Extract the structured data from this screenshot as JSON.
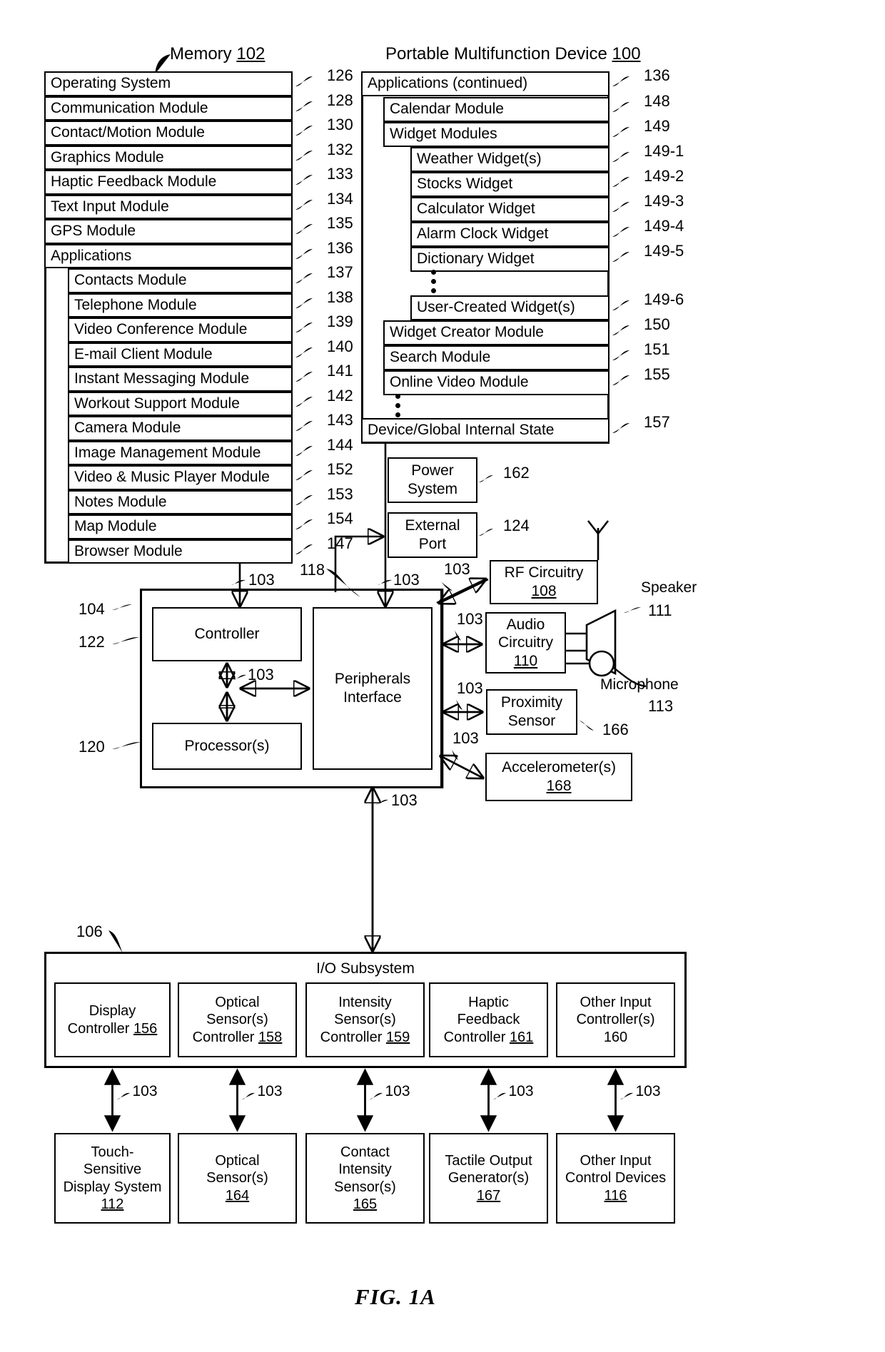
{
  "figure": {
    "caption": "FIG. 1A",
    "memory_title": "Memory",
    "memory_ref": "102",
    "device_title": "Portable Multifunction Device",
    "device_ref": "100"
  },
  "memory_column": {
    "items": [
      {
        "label": "Operating System",
        "ref": "126",
        "indent": 0
      },
      {
        "label": "Communication Module",
        "ref": "128",
        "indent": 0
      },
      {
        "label": "Contact/Motion Module",
        "ref": "130",
        "indent": 0
      },
      {
        "label": "Graphics Module",
        "ref": "132",
        "indent": 0
      },
      {
        "label": "Haptic Feedback Module",
        "ref": "133",
        "indent": 0
      },
      {
        "label": "Text Input Module",
        "ref": "134",
        "indent": 0
      },
      {
        "label": "GPS Module",
        "ref": "135",
        "indent": 0
      },
      {
        "label": "Applications",
        "ref": "136",
        "indent": 0
      },
      {
        "label": "Contacts Module",
        "ref": "137",
        "indent": 1
      },
      {
        "label": "Telephone Module",
        "ref": "138",
        "indent": 1
      },
      {
        "label": "Video Conference Module",
        "ref": "139",
        "indent": 1
      },
      {
        "label": "E-mail Client Module",
        "ref": "140",
        "indent": 1
      },
      {
        "label": "Instant Messaging Module",
        "ref": "141",
        "indent": 1
      },
      {
        "label": "Workout Support Module",
        "ref": "142",
        "indent": 1
      },
      {
        "label": "Camera Module",
        "ref": "143",
        "indent": 1
      },
      {
        "label": "Image Management Module",
        "ref": "144",
        "indent": 1
      },
      {
        "label": "Video & Music Player Module",
        "ref": "152",
        "indent": 1
      },
      {
        "label": "Notes Module",
        "ref": "153",
        "indent": 1
      },
      {
        "label": "Map Module",
        "ref": "154",
        "indent": 1
      },
      {
        "label": "Browser Module",
        "ref": "147",
        "indent": 1
      }
    ]
  },
  "applications_column": {
    "items": [
      {
        "label": "Applications (continued)",
        "ref": "136",
        "indent": 0
      },
      {
        "label": "Calendar Module",
        "ref": "148",
        "indent": 1
      },
      {
        "label": "Widget Modules",
        "ref": "149",
        "indent": 1
      },
      {
        "label": "Weather Widget(s)",
        "ref": "149-1",
        "indent": 2
      },
      {
        "label": "Stocks Widget",
        "ref": "149-2",
        "indent": 2
      },
      {
        "label": "Calculator Widget",
        "ref": "149-3",
        "indent": 2
      },
      {
        "label": "Alarm Clock Widget",
        "ref": "149-4",
        "indent": 2
      },
      {
        "label": "Dictionary Widget",
        "ref": "149-5",
        "indent": 2
      },
      {
        "label": "User-Created Widget(s)",
        "ref": "149-6",
        "indent": 2
      },
      {
        "label": "Widget Creator Module",
        "ref": "150",
        "indent": 1
      },
      {
        "label": "Search Module",
        "ref": "151",
        "indent": 1
      },
      {
        "label": "Online Video Module",
        "ref": "155",
        "indent": 1
      },
      {
        "label": "Device/Global Internal State",
        "ref": "157",
        "indent": 0
      }
    ]
  },
  "hardware": {
    "power_system": {
      "label": "Power\nSystem",
      "line1": "Power",
      "line2": "System",
      "ref": "162"
    },
    "external_port": {
      "line1": "External",
      "line2": "Port",
      "ref": "124"
    },
    "rf_circuitry": {
      "line1": "RF Circuitry",
      "ref_inline": "108"
    },
    "audio_circuitry": {
      "line1": "Audio",
      "line2": "Circuitry",
      "ref_inline": "110"
    },
    "proximity_sensor": {
      "line1": "Proximity",
      "line2": "Sensor",
      "ref": "166"
    },
    "accelerometers": {
      "line1": "Accelerometer(s)",
      "ref_inline": "168"
    },
    "speaker": {
      "label": "Speaker",
      "ref": "111"
    },
    "microphone": {
      "label": "Microphone",
      "ref": "113"
    },
    "controller": {
      "label": "Controller",
      "ref_a": "104",
      "ref_b": "122"
    },
    "peripherals_interface": {
      "line1": "Peripherals",
      "line2": "Interface",
      "ref": "118"
    },
    "processors": {
      "label": "Processor(s)",
      "ref": "120"
    },
    "bus_ref": "103"
  },
  "io_subsystem": {
    "title": "I/O Subsystem",
    "ref": "106",
    "controllers": [
      {
        "lines": [
          "Display",
          "Controller 156"
        ],
        "ref_inline": "156"
      },
      {
        "lines": [
          "Optical",
          "Sensor(s)",
          "Controller 158"
        ],
        "ref_inline": "158"
      },
      {
        "lines": [
          "Intensity",
          "Sensor(s)",
          "Controller 159"
        ],
        "ref_inline": "159"
      },
      {
        "lines": [
          "Haptic",
          "Feedback",
          "Controller 161"
        ],
        "ref_inline": "161"
      },
      {
        "lines": [
          "Other Input",
          "Controller(s)",
          "160"
        ],
        "ref_inline": "160"
      }
    ],
    "devices": [
      {
        "lines": [
          "Touch-",
          "Sensitive",
          "Display System",
          "112"
        ],
        "ref_inline": "112"
      },
      {
        "lines": [
          "Optical",
          "Sensor(s)",
          "164"
        ],
        "ref_inline": "164"
      },
      {
        "lines": [
          "Contact",
          "Intensity",
          "Sensor(s)",
          "165"
        ],
        "ref_inline": "165"
      },
      {
        "lines": [
          "Tactile Output",
          "Generator(s)",
          "167"
        ],
        "ref_inline": "167"
      },
      {
        "lines": [
          "Other Input",
          "Control Devices",
          "116"
        ],
        "ref_inline": "116"
      }
    ],
    "link_ref": "103"
  }
}
